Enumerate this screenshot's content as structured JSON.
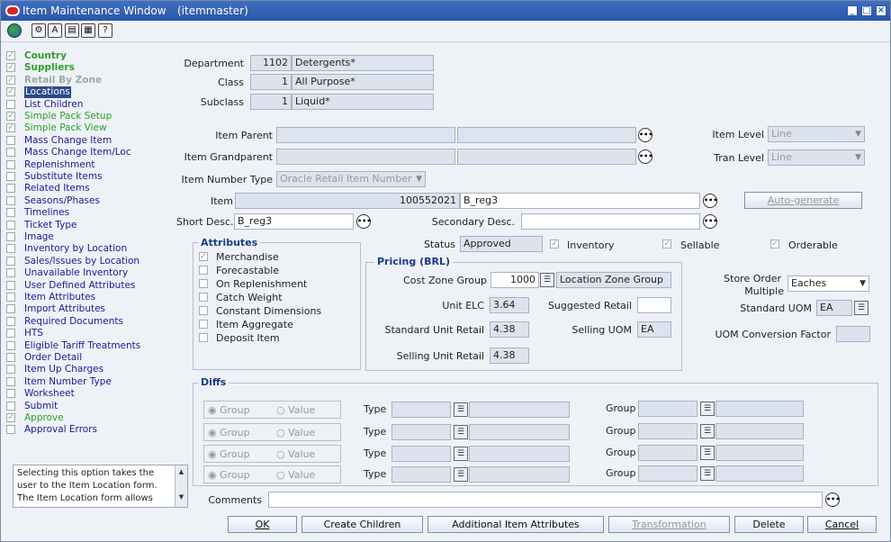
{
  "window": {
    "title": "Item Maintenance Window",
    "subtitle": "(itemmaster)"
  },
  "nav": [
    {
      "label": "Country",
      "checked": true,
      "style": "green bold"
    },
    {
      "label": "Suppliers",
      "checked": true,
      "style": "green bold"
    },
    {
      "label": "Retail By Zone",
      "checked": true,
      "style": "gray bold"
    },
    {
      "label": "Locations",
      "checked": true,
      "style": "sel"
    },
    {
      "label": "List Children",
      "checked": false,
      "style": "blue"
    },
    {
      "label": "Simple Pack Setup",
      "checked": true,
      "style": "green"
    },
    {
      "label": "Simple Pack View",
      "checked": true,
      "style": "green"
    },
    {
      "label": "Mass Change Item",
      "checked": false,
      "style": "blue"
    },
    {
      "label": "Mass Change Item/Loc",
      "checked": false,
      "style": "blue"
    },
    {
      "label": "Replenishment",
      "checked": false,
      "style": "blue"
    },
    {
      "label": "Substitute Items",
      "checked": false,
      "style": "blue"
    },
    {
      "label": "Related Items",
      "checked": false,
      "style": "blue"
    },
    {
      "label": "Seasons/Phases",
      "checked": false,
      "style": "blue"
    },
    {
      "label": "Timelines",
      "checked": false,
      "style": "blue"
    },
    {
      "label": "Ticket Type",
      "checked": false,
      "style": "blue"
    },
    {
      "label": "Image",
      "checked": false,
      "style": "blue"
    },
    {
      "label": "Inventory by Location",
      "checked": false,
      "style": "blue"
    },
    {
      "label": "Sales/Issues by Location",
      "checked": false,
      "style": "blue"
    },
    {
      "label": "Unavailable Inventory",
      "checked": false,
      "style": "blue"
    },
    {
      "label": "User Defined Attributes",
      "checked": false,
      "style": "blue"
    },
    {
      "label": "Item Attributes",
      "checked": false,
      "style": "blue"
    },
    {
      "label": "Import Attributes",
      "checked": false,
      "style": "blue"
    },
    {
      "label": "Required Documents",
      "checked": false,
      "style": "blue"
    },
    {
      "label": "HTS",
      "checked": false,
      "style": "blue"
    },
    {
      "label": "Eligible Tariff Treatments",
      "checked": false,
      "style": "blue"
    },
    {
      "label": "Order Detail",
      "checked": false,
      "style": "blue"
    },
    {
      "label": "Item Up Charges",
      "checked": false,
      "style": "blue"
    },
    {
      "label": "Item Number Type",
      "checked": false,
      "style": "blue"
    },
    {
      "label": "Worksheet",
      "checked": false,
      "style": "blue"
    },
    {
      "label": "Submit",
      "checked": false,
      "style": "blue"
    },
    {
      "label": "Approve",
      "checked": true,
      "style": "green"
    },
    {
      "label": "Approval Errors",
      "checked": false,
      "style": "blue"
    }
  ],
  "hint": "Selecting this option takes the user to the Item Location form. The Item Location form allows the user to",
  "hier": {
    "department": {
      "label": "Department",
      "code": "1102",
      "name": "Detergents*"
    },
    "class": {
      "label": "Class",
      "code": "1",
      "name": "All Purpose*"
    },
    "subclass": {
      "label": "Subclass",
      "code": "1",
      "name": "Liquid*"
    }
  },
  "item": {
    "parent_label": "Item Parent",
    "grandparent_label": "Item Grandparent",
    "item_level_label": "Item Level",
    "item_level": "Line",
    "tran_level_label": "Tran Level",
    "tran_level": "Line",
    "number_type_label": "Item Number Type",
    "number_type": "Oracle Retail Item Number",
    "item_label": "Item",
    "item_number": "100552021",
    "item_desc": "B_reg3",
    "autogen": "Auto-generate",
    "short_desc_label": "Short Desc.",
    "short_desc": "B_reg3",
    "secondary_desc_label": "Secondary Desc.",
    "status_label": "Status",
    "status": "Approved",
    "inventory": "Inventory",
    "sellable": "Sellable",
    "orderable": "Orderable"
  },
  "attributes": {
    "title": "Attributes",
    "items": [
      {
        "label": "Merchandise",
        "checked": true
      },
      {
        "label": "Forecastable",
        "checked": false
      },
      {
        "label": "On Replenishment",
        "checked": false
      },
      {
        "label": "Catch Weight",
        "checked": false
      },
      {
        "label": "Constant Dimensions",
        "checked": false
      },
      {
        "label": "Item Aggregate",
        "checked": false
      },
      {
        "label": "Deposit Item",
        "checked": false
      }
    ]
  },
  "pricing": {
    "title": "Pricing (BRL)",
    "czg_label": "Cost Zone Group",
    "czg_code": "1000",
    "czg_name": "Location Zone Group",
    "unit_elc_label": "Unit ELC",
    "unit_elc": "3.64",
    "suggested_label": "Suggested Retail",
    "std_retail_label": "Standard Unit Retail",
    "std_retail": "4.38",
    "selling_uom_label": "Selling UOM",
    "selling_uom": "EA",
    "selling_retail_label": "Selling Unit Retail",
    "selling_retail": "4.38"
  },
  "uom": {
    "store_order_label_1": "Store Order",
    "store_order_label_2": "Multiple",
    "store_order": "Eaches",
    "std_uom_label": "Standard UOM",
    "std_uom": "EA",
    "conv_label": "UOM Conversion Factor"
  },
  "diffs": {
    "title": "Diffs",
    "group_opt": "Group",
    "value_opt": "Value",
    "type_label": "Type",
    "group_label": "Group"
  },
  "comments_label": "Comments",
  "buttons": {
    "ok": "OK",
    "create_children": "Create Children",
    "additional": "Additional Item Attributes",
    "transformation": "Transformation",
    "delete": "Delete",
    "cancel": "Cancel"
  }
}
